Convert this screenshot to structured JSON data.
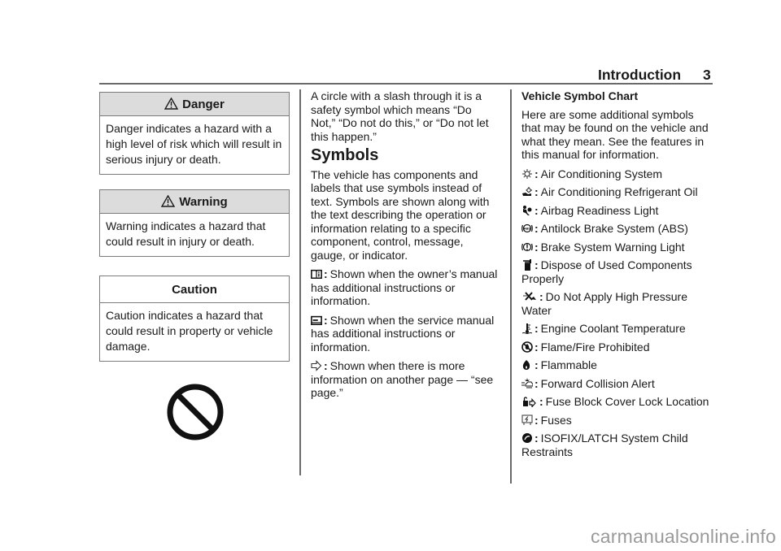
{
  "header": {
    "section_title": "Introduction",
    "page_number": "3"
  },
  "notices": [
    {
      "icon": "warning-triangle-icon",
      "title": "Danger",
      "body": "Danger indicates a hazard with a high level of risk which will result in serious injury or death."
    },
    {
      "icon": "warning-triangle-icon",
      "title": "Warning",
      "body": "Warning indicates a hazard that could result in injury or death."
    },
    {
      "icon": null,
      "title": "Caution",
      "body": "Caution indicates a hazard that could result in property or vehicle damage."
    }
  ],
  "no_symbol": {
    "icon": "prohibition-circle-icon"
  },
  "column2": {
    "intro": "A circle with a slash through it is a safety symbol which means “Do Not,” “Do not do this,” or “Do not let this happen.”",
    "heading": "Symbols",
    "paragraph": "The vehicle has components and labels that use symbols instead of text. Symbols are shown along with the text describing the operation or information relating to a specific component, control, message, gauge, or indicator.",
    "symbol_items": [
      {
        "icon": "owners-manual-icon",
        "text": "Shown when the owner’s manual has additional instructions or information."
      },
      {
        "icon": "service-manual-icon",
        "text": "Shown when the service manual has additional instructions or information."
      },
      {
        "icon": "see-page-arrow-icon",
        "text": "Shown when there is more information on another page — “see page.”"
      }
    ]
  },
  "column3": {
    "heading": "Vehicle Symbol Chart",
    "intro": "Here are some additional symbols that may be found on the vehicle and what they mean. See the features in this manual for information.",
    "symbols": [
      {
        "icon": "air-conditioning-icon",
        "label": "Air Conditioning System"
      },
      {
        "icon": "ac-refrigerant-oil-icon",
        "label": "Air Conditioning Refrigerant Oil"
      },
      {
        "icon": "airbag-readiness-icon",
        "label": "Airbag Readiness Light"
      },
      {
        "icon": "abs-icon",
        "label": "Antilock Brake System (ABS)"
      },
      {
        "icon": "brake-warning-icon",
        "label": "Brake System Warning Light"
      },
      {
        "icon": "dispose-components-icon",
        "label": "Dispose of Used Components Properly"
      },
      {
        "icon": "no-high-pressure-water-icon",
        "label": "Do Not Apply High Pressure Water"
      },
      {
        "icon": "coolant-temperature-icon",
        "label": "Engine Coolant Temperature"
      },
      {
        "icon": "flame-prohibited-icon",
        "label": "Flame/Fire Prohibited"
      },
      {
        "icon": "flammable-icon",
        "label": "Flammable"
      },
      {
        "icon": "forward-collision-alert-icon",
        "label": "Forward Collision Alert"
      },
      {
        "icon": "fuse-block-lock-icon",
        "label": "Fuse Block Cover Lock Location"
      },
      {
        "icon": "fuses-icon",
        "label": "Fuses"
      },
      {
        "icon": "isofix-latch-icon",
        "label": "ISOFIX/LATCH System Child Restraints"
      }
    ]
  },
  "separator": ":",
  "watermark": "carmanualsonline.info"
}
